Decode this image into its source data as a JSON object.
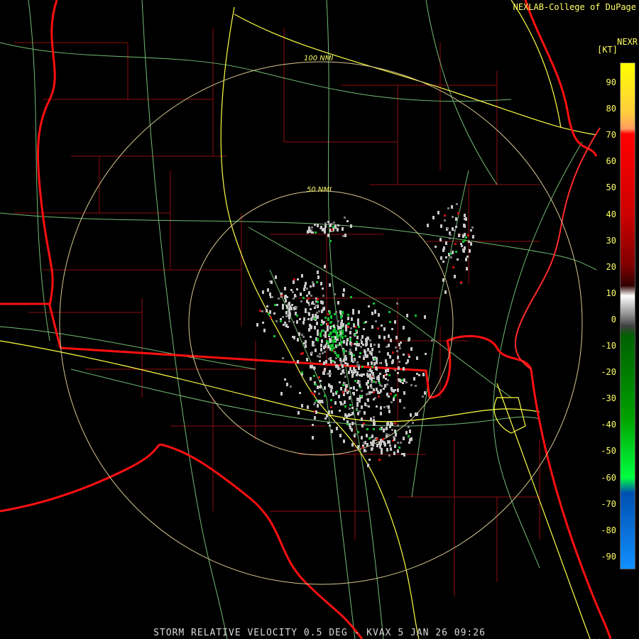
{
  "header": {
    "credit": "NEXLAB-College of DuPage",
    "product_code": "NEXR",
    "units": "[KT]"
  },
  "caption": "STORM RELATIVE VELOCITY 0.5 DEG - KVAX 5 JAN 26 09:26",
  "range_rings": {
    "inner_label": "50 NMI",
    "outer_label": "100 NMI"
  },
  "colorbar": {
    "ticks": [
      "90",
      "80",
      "70",
      "60",
      "50",
      "40",
      "30",
      "20",
      "10",
      "0",
      "-10",
      "-20",
      "-30",
      "-40",
      "-50",
      "-60",
      "-70",
      "-80",
      "-90"
    ]
  },
  "colors": {
    "state_border": "#ff1010",
    "county_border": "#b01010",
    "highway": "#ffff44",
    "road": "#88dd88",
    "range_ring": "#d8c890",
    "label": "#ffff66",
    "inbound": "#10c030",
    "outbound": "#d01010",
    "near_zero": "#c8c8c8"
  }
}
